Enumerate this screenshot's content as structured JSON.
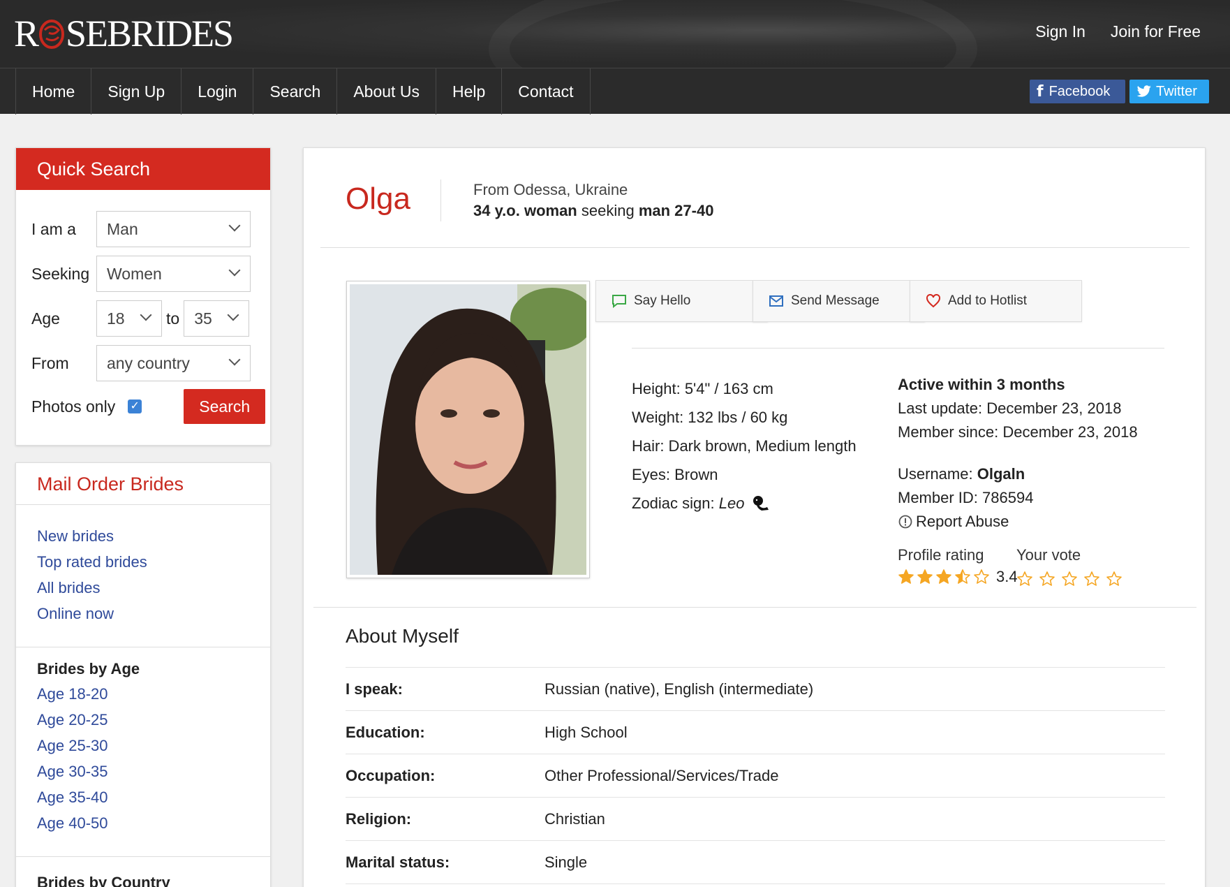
{
  "header": {
    "logo_text_1": "R",
    "logo_text_2": "SEBRIDES",
    "sign_in": "Sign In",
    "join": "Join for Free"
  },
  "nav": {
    "items": [
      "Home",
      "Sign Up",
      "Login",
      "Search",
      "About Us",
      "Help",
      "Contact"
    ],
    "facebook": "Facebook",
    "twitter": "Twitter"
  },
  "quick_search": {
    "title": "Quick Search",
    "i_am_label": "I am a",
    "i_am_value": "Man",
    "seeking_label": "Seeking",
    "seeking_value": "Women",
    "age_label": "Age",
    "age_from": "18",
    "age_to_label": "to",
    "age_to": "35",
    "from_label": "From",
    "from_value": "any country",
    "photos_only_label": "Photos only",
    "photos_only_checked": true,
    "search_button": "Search"
  },
  "mail_order": {
    "title": "Mail Order Brides",
    "links": [
      "New brides",
      "Top rated brides",
      "All brides",
      "Online now"
    ],
    "by_age_title": "Brides by Age",
    "age_links": [
      "Age 18-20",
      "Age 20-25",
      "Age 25-30",
      "Age 30-35",
      "Age 35-40",
      "Age 40-50"
    ],
    "by_country_title": "Brides by Country"
  },
  "profile": {
    "name": "Olga",
    "from": "From Odessa, Ukraine",
    "seek_1": "34 y.o. woman",
    "seek_2": " seeking ",
    "seek_3": "man 27-40",
    "actions": {
      "say_hello": "Say Hello",
      "send_message": "Send Message",
      "add_hotlist": "Add to Hotlist"
    },
    "facts": {
      "height": "Height: 5'4\" / 163 cm",
      "weight": "Weight: 132 lbs / 60 kg",
      "hair": "Hair: Dark brown, Medium length",
      "eyes": "Eyes: Brown",
      "zodiac_label": "Zodiac sign: ",
      "zodiac_value": "Leo"
    },
    "info": {
      "active": "Active within 3 months",
      "last_update": "Last update: December 23, 2018",
      "member_since": "Member since: December 23, 2018",
      "username_label": "Username: ",
      "username": "Olgaln",
      "member_id": "Member ID: 786594",
      "report": "Report Abuse"
    },
    "rating": {
      "profile_rating_label": "Profile rating",
      "profile_rating": 3.4,
      "profile_rating_text": "3.4",
      "your_vote_label": "Your vote",
      "your_vote": 0,
      "max": 5,
      "star_color": "#f5a623"
    },
    "about": {
      "title": "About Myself",
      "rows": [
        {
          "k": "I speak:",
          "v": "Russian (native), English (intermediate)"
        },
        {
          "k": "Education:",
          "v": "High School"
        },
        {
          "k": "Occupation:",
          "v": "Other Professional/Services/Trade"
        },
        {
          "k": "Religion:",
          "v": "Christian"
        },
        {
          "k": "Marital status:",
          "v": "Single"
        }
      ]
    }
  },
  "colors": {
    "brand_red": "#d42a20",
    "link_blue": "#2f4a9a",
    "facebook": "#3b5998",
    "twitter": "#2aa3ef"
  }
}
